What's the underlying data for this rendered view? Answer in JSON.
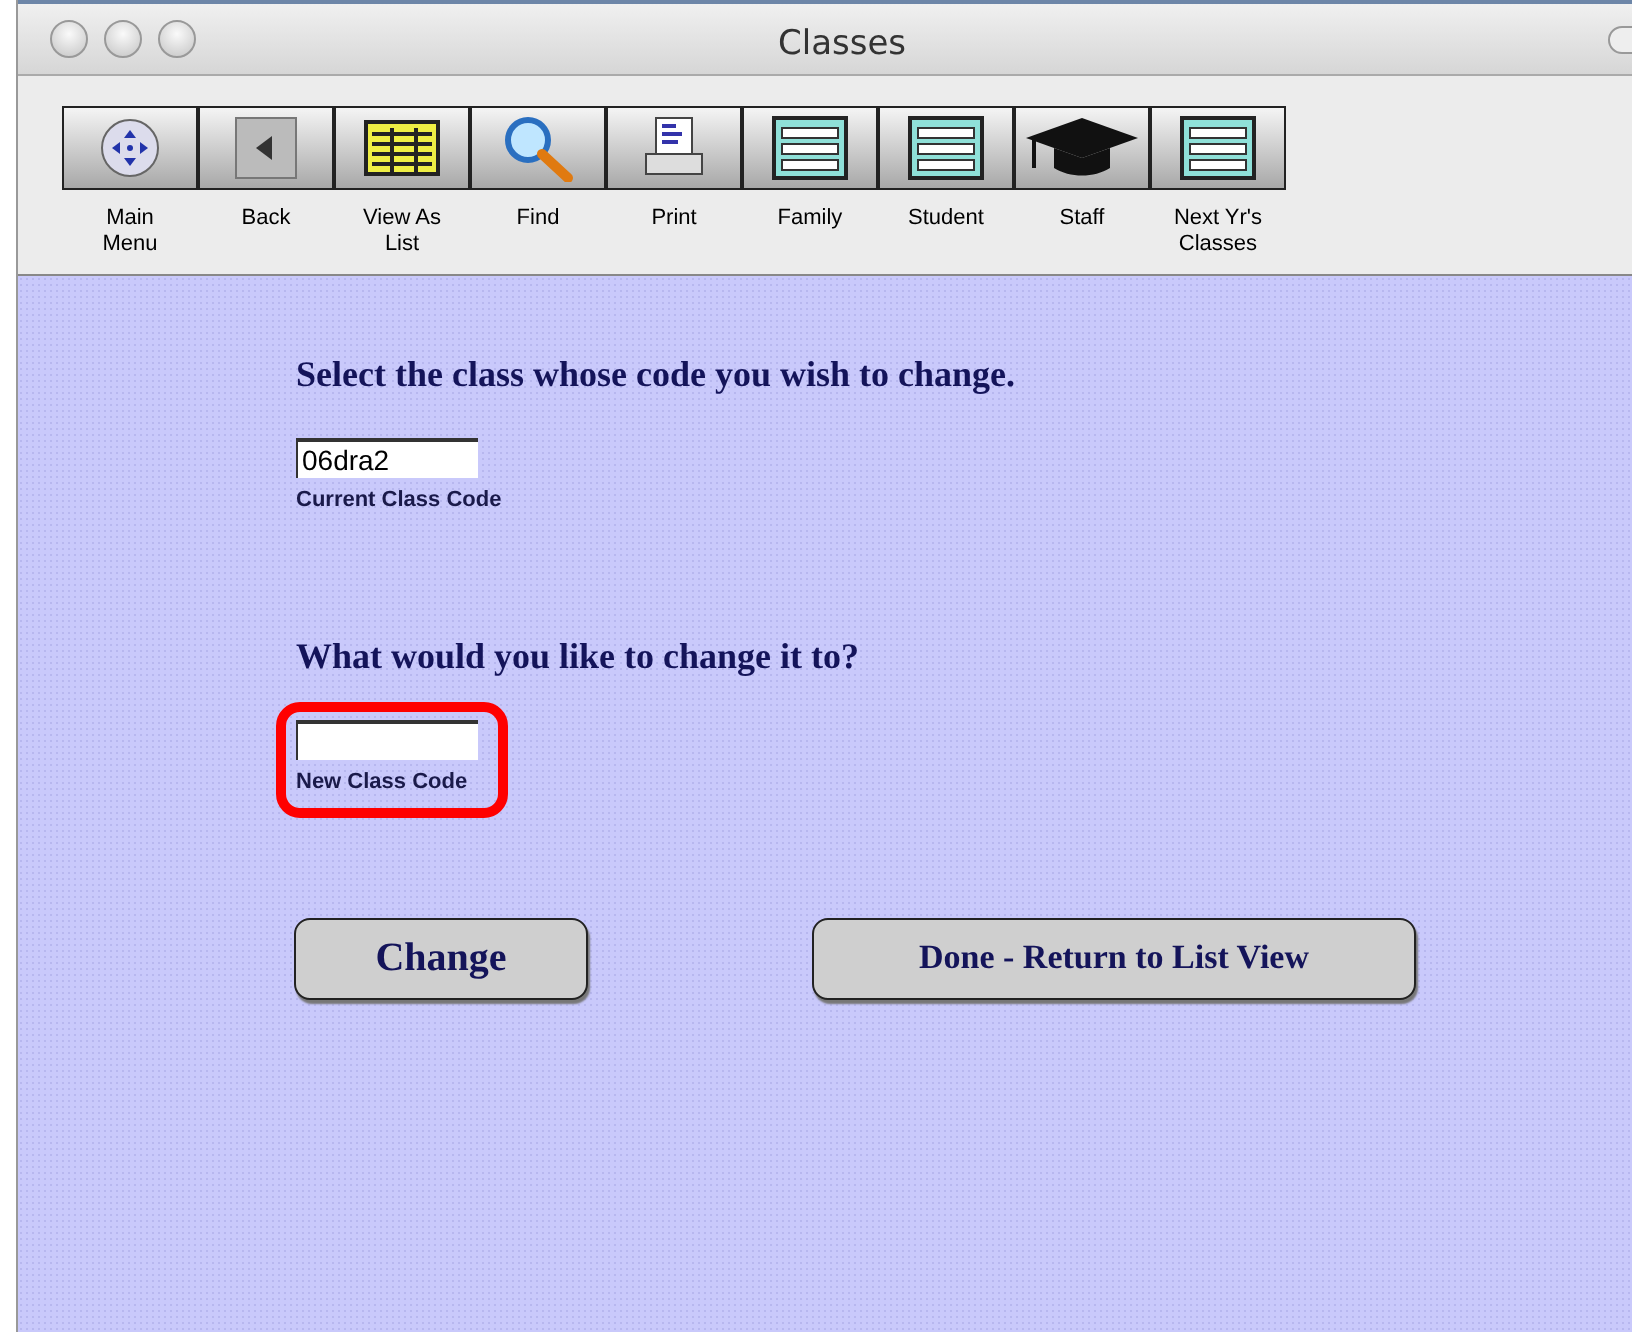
{
  "window": {
    "title": "Classes"
  },
  "toolbar": [
    {
      "kind": "menu",
      "label": "Main\nMenu"
    },
    {
      "kind": "back",
      "label": "Back"
    },
    {
      "kind": "list",
      "label": "View As\nList"
    },
    {
      "kind": "find",
      "label": "Find"
    },
    {
      "kind": "print",
      "label": "Print"
    },
    {
      "kind": "layout",
      "label": "Family"
    },
    {
      "kind": "layout",
      "label": "Student"
    },
    {
      "kind": "grad",
      "label": "Staff"
    },
    {
      "kind": "layout",
      "label": "Next Yr's\nClasses"
    }
  ],
  "form": {
    "prompt_1": "Select the class whose code you wish to change.",
    "current_code": {
      "value": "06dra2",
      "label": "Current Class Code",
      "highlighted": false
    },
    "prompt_2": "What would you like to change it to?",
    "new_code": {
      "label": "New Class Code",
      "highlighted": true
    }
  },
  "buttons": [
    {
      "kind": "small",
      "label": "Change"
    },
    {
      "kind": "wide",
      "label": "Done - Return to List View"
    }
  ]
}
